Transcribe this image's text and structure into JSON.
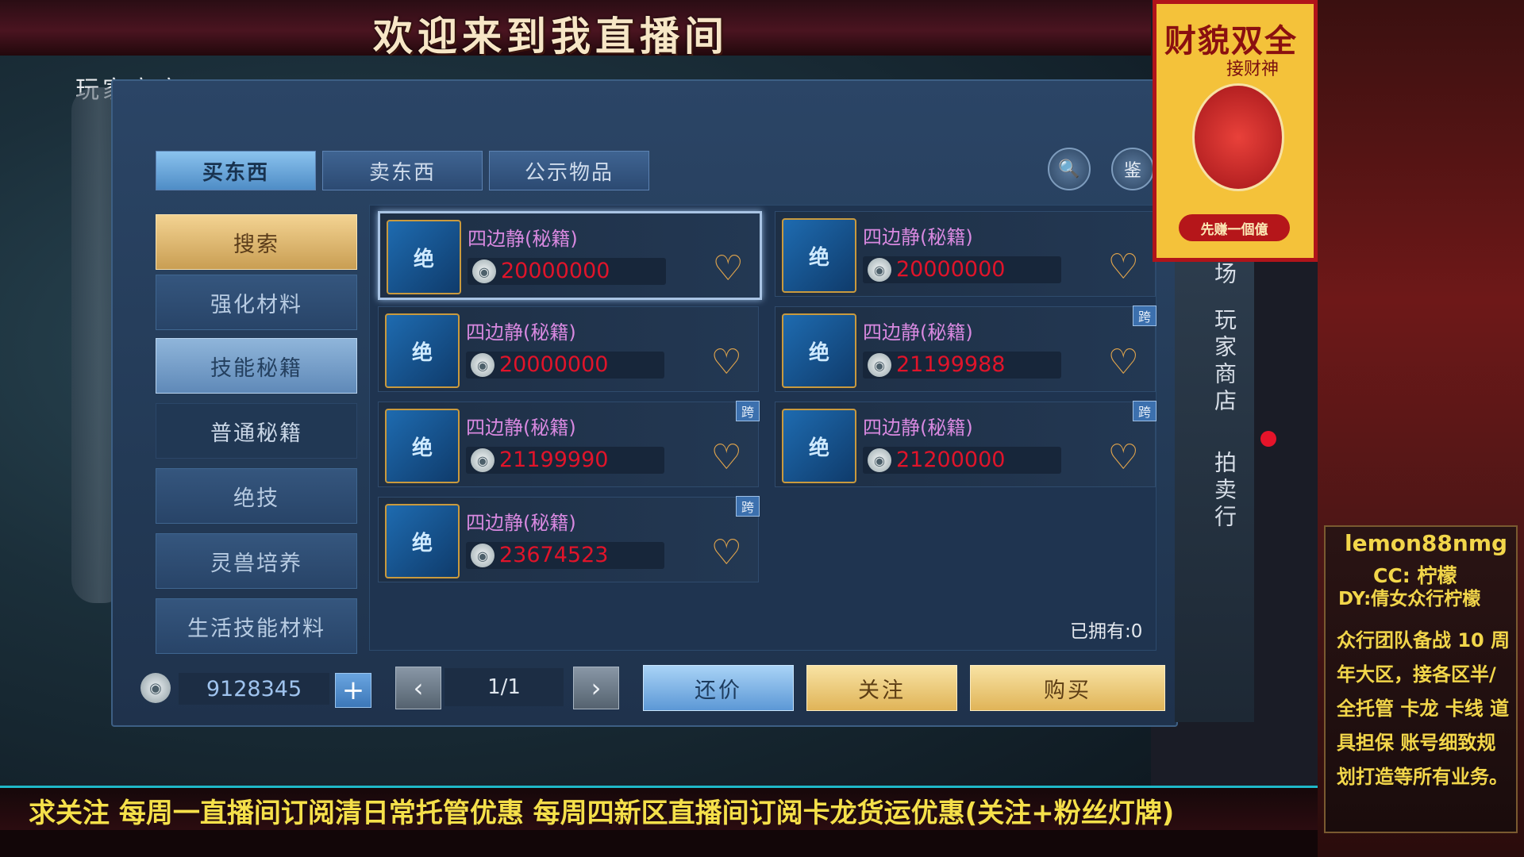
{
  "banner": {
    "title": "欢迎来到我直播间"
  },
  "game": {
    "header": "玩家商店",
    "tabs": [
      {
        "label": "买东西",
        "active": true
      },
      {
        "label": "卖东西",
        "active": false
      },
      {
        "label": "公示物品",
        "active": false
      }
    ],
    "tab_icons": [
      {
        "icon": "search-scroll-icon",
        "glyph": "🔍"
      },
      {
        "icon": "appraise-icon",
        "glyph": "鉴"
      }
    ],
    "categories": [
      {
        "label": "搜索",
        "state": "active"
      },
      {
        "label": "强化材料",
        "state": "normal"
      },
      {
        "label": "技能秘籍",
        "state": "selected"
      },
      {
        "label": "普通秘籍",
        "state": "sub"
      },
      {
        "label": "绝技",
        "state": "normal"
      },
      {
        "label": "灵兽培养",
        "state": "normal"
      },
      {
        "label": "生活技能材料",
        "state": "normal"
      }
    ],
    "items": [
      {
        "name": "四边静(秘籍)",
        "price": "20000000",
        "cross": false,
        "selected": true
      },
      {
        "name": "四边静(秘籍)",
        "price": "20000000",
        "cross": false,
        "selected": false
      },
      {
        "name": "四边静(秘籍)",
        "price": "20000000",
        "cross": false,
        "selected": false
      },
      {
        "name": "四边静(秘籍)",
        "price": "21199988",
        "cross": true,
        "selected": false
      },
      {
        "name": "四边静(秘籍)",
        "price": "21199990",
        "cross": true,
        "selected": false
      },
      {
        "name": "四边静(秘籍)",
        "price": "21200000",
        "cross": true,
        "selected": false
      },
      {
        "name": "四边静(秘籍)",
        "price": "23674523",
        "cross": true,
        "selected": false
      }
    ],
    "item_icon_glyph": "绝",
    "cross_label": "跨",
    "owned": "已拥有:0",
    "balance": "9128345",
    "plus_label": "+",
    "page": "1/1",
    "prev_glyph": "‹",
    "next_glyph": "›",
    "actions": {
      "counter": "还价",
      "follow": "关注",
      "buy": "购买"
    },
    "side_tabs": [
      "场",
      "玩家商店",
      "拍卖行"
    ],
    "colors": {
      "price": "#e0142a",
      "item_name": "#d889e0",
      "heart": "#e3a64c"
    }
  },
  "poster": {
    "title": "财貌双全",
    "subtitle": "接财神",
    "motto": "先赚一個億"
  },
  "streamer": {
    "id": "lemon88nmg",
    "cc": "CC: 柠檬",
    "dy": "DY:倩女众行柠檬",
    "info": "众行团队备战 10 周年大区，接各区半/全托管 卡龙 卡线 道具担保 账号细致规划打造等所有业务。"
  },
  "ticker": {
    "text": "求关注 每周一直播间订阅清日常托管优惠 每周四新区直播间订阅卡龙货运优惠(关注+粉丝灯牌)"
  }
}
